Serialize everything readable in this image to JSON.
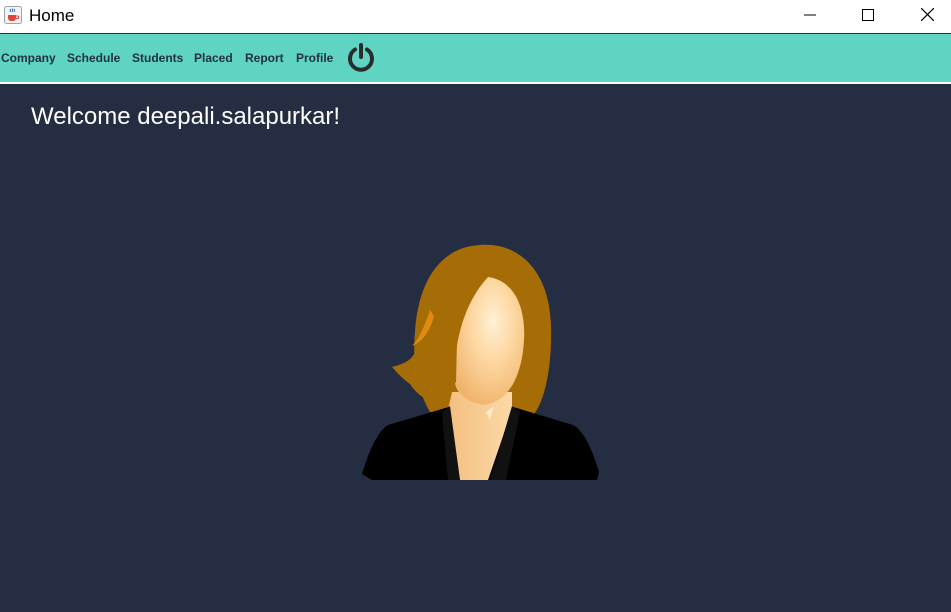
{
  "window": {
    "title": "Home",
    "icon": "java-coffee-icon"
  },
  "window_controls": {
    "minimize_icon": "minimize-icon",
    "maximize_icon": "maximize-icon",
    "close_icon": "close-icon"
  },
  "menu": {
    "background": "#5fd4c3",
    "items": [
      {
        "label": "Company"
      },
      {
        "label": "Schedule"
      },
      {
        "label": "Students"
      },
      {
        "label": "Placed"
      },
      {
        "label": "Report"
      },
      {
        "label": "Profile"
      }
    ],
    "logout_icon": "power-icon"
  },
  "main": {
    "background": "#242d41",
    "welcome_text": "Welcome deepali.salapurkar!",
    "avatar_icon": "woman-avatar-icon"
  }
}
